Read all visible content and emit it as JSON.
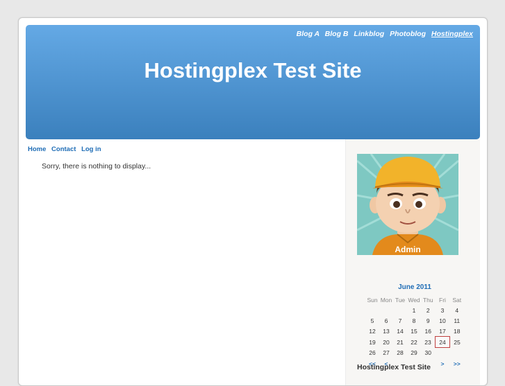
{
  "header": {
    "blog_links": [
      "Blog A",
      "Blog B",
      "Linkblog",
      "Photoblog",
      "Hostingplex"
    ],
    "title": "Hostingplex Test Site"
  },
  "menu": {
    "home": "Home",
    "contact": "Contact",
    "login": "Log in"
  },
  "main": {
    "empty_message": "Sorry, there is nothing to display..."
  },
  "sidebar": {
    "avatar_label": "Admin",
    "calendar": {
      "month": "June 2011",
      "weekdays": [
        "Sun",
        "Mon",
        "Tue",
        "Wed",
        "Thu",
        "Fri",
        "Sat"
      ],
      "weeks": [
        [
          "",
          "",
          "",
          "1",
          "2",
          "3",
          "4"
        ],
        [
          "5",
          "6",
          "7",
          "8",
          "9",
          "10",
          "11"
        ],
        [
          "12",
          "13",
          "14",
          "15",
          "16",
          "17",
          "18"
        ],
        [
          "19",
          "20",
          "21",
          "22",
          "23",
          "24",
          "25"
        ],
        [
          "26",
          "27",
          "28",
          "29",
          "30",
          "",
          ""
        ]
      ],
      "today": "24",
      "nav": {
        "prev_year": "<<",
        "prev_month": "<",
        "next_month": ">",
        "next_year": ">>"
      }
    },
    "widget_title": "Hostingplex Test Site"
  },
  "colors": {
    "header_top": "#64a9e5",
    "header_bottom": "#3b80bd",
    "link": "#1f6db6",
    "today_border": "#c04040"
  }
}
